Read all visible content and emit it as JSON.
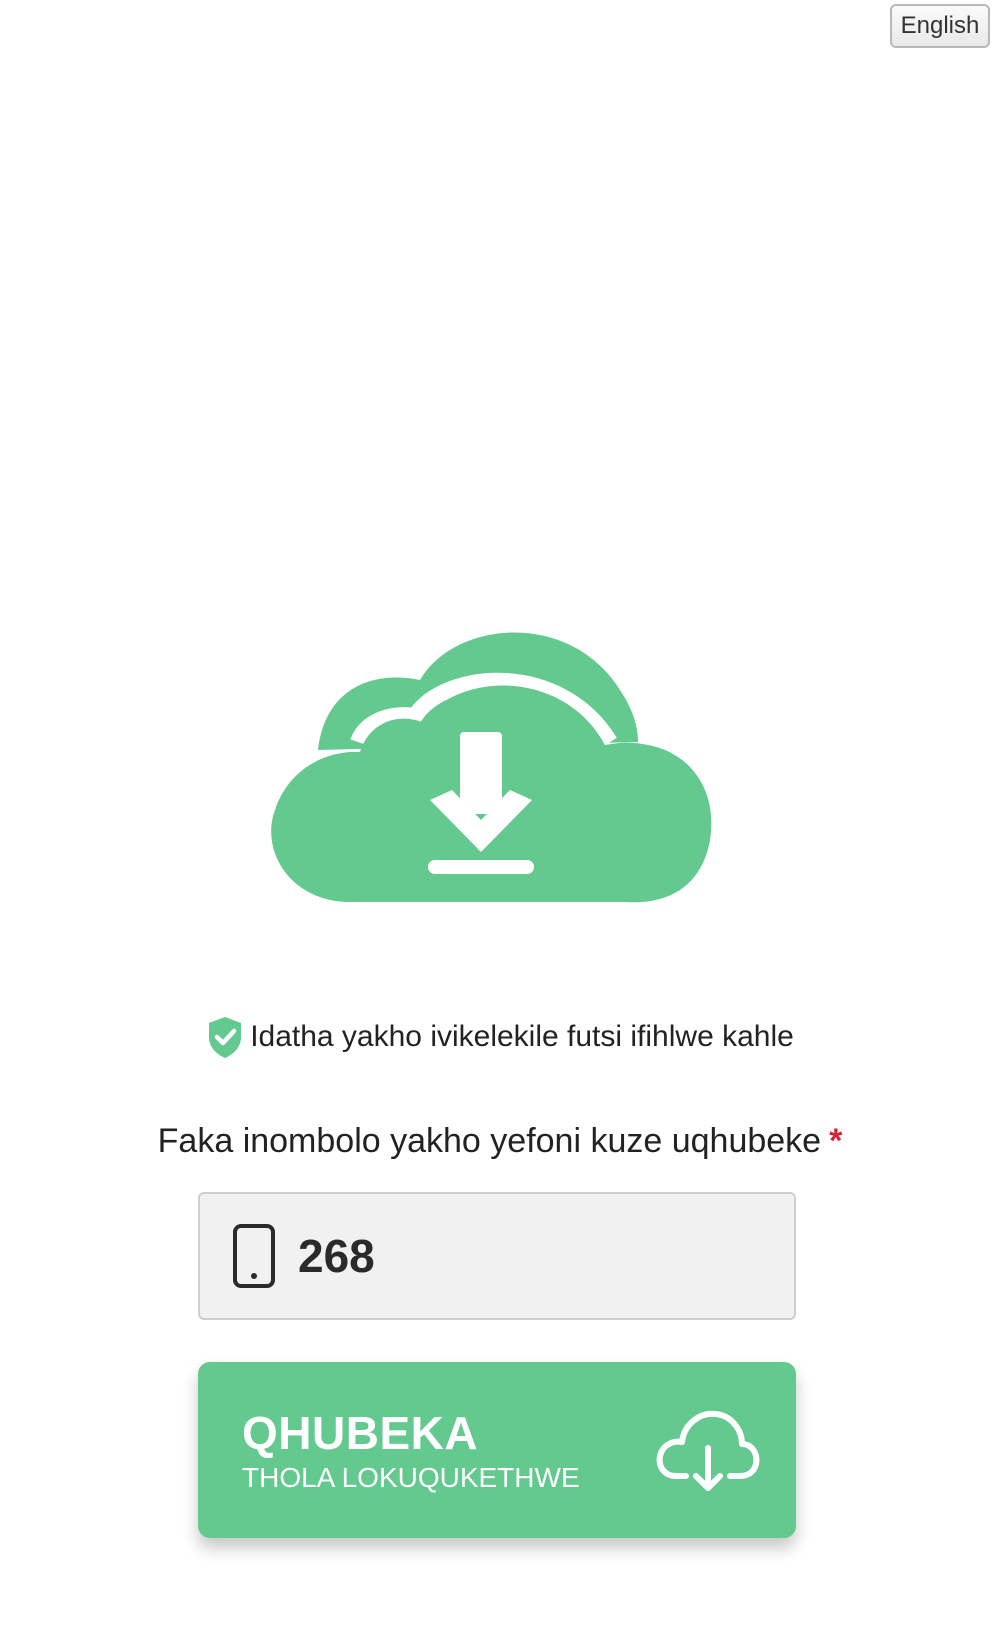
{
  "header": {
    "language_button": "English"
  },
  "hero": {
    "icon": "cloud-download-icon",
    "color": "#63c98e"
  },
  "security": {
    "icon": "shield-check-icon",
    "text": "Idatha yakho ivikelekile futsi ifihlwe kahle"
  },
  "form": {
    "prompt": "Faka inombolo yakho yefoni kuze uqhubeke",
    "required_mark": "*",
    "phone_icon": "mobile-phone-icon",
    "phone_value": "268"
  },
  "cta": {
    "title": "QHUBEKA",
    "subtitle": "THOLA LOKUQUKETHWE",
    "icon": "cloud-download-outline-icon",
    "color": "#63c98e"
  }
}
